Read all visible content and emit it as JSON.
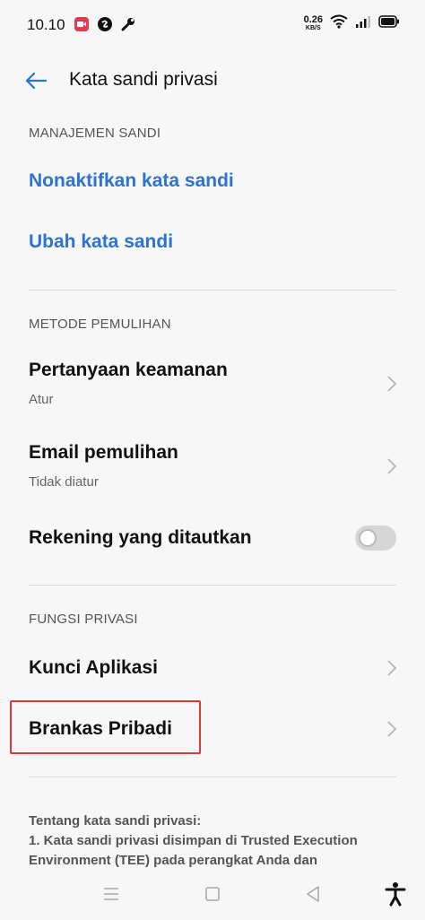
{
  "status_bar": {
    "time": "10.10",
    "speed_value": "0.26",
    "speed_unit": "KB/S",
    "icons": [
      "screen-record-icon",
      "shazam-icon",
      "wrench-icon",
      "wifi-icon",
      "signal-icon",
      "battery-icon"
    ]
  },
  "app_bar": {
    "title": "Kata sandi privasi",
    "back_icon": "back-arrow-icon"
  },
  "sections": {
    "password_management": {
      "header": "MANAJEMEN SANDI",
      "disable_label": "Nonaktifkan kata sandi",
      "change_label": "Ubah kata sandi"
    },
    "recovery": {
      "header": "METODE PEMULIHAN",
      "security_question_title": "Pertanyaan keamanan",
      "security_question_sub": "Atur",
      "recovery_email_title": "Email pemulihan",
      "recovery_email_sub": "Tidak diatur",
      "linked_account_title": "Rekening yang ditautkan",
      "linked_account_enabled": false
    },
    "privacy_functions": {
      "header": "FUNGSI PRIVASI",
      "app_lock_title": "Kunci Aplikasi",
      "private_vault_title": "Brankas Pribadi"
    }
  },
  "footnote": {
    "line1": "Tentang kata sandi privasi:",
    "line2": "1. Kata sandi privasi disimpan di Trusted Execution",
    "line3": "Environment (TEE) pada perangkat Anda dan"
  },
  "colors": {
    "accent_blue": "#2c73d2",
    "highlight_red": "#d93a3a",
    "background": "#f7f7f7"
  },
  "nav_bar": {
    "icons": [
      "menu-icon",
      "home-icon",
      "back-icon",
      "accessibility-icon"
    ]
  }
}
